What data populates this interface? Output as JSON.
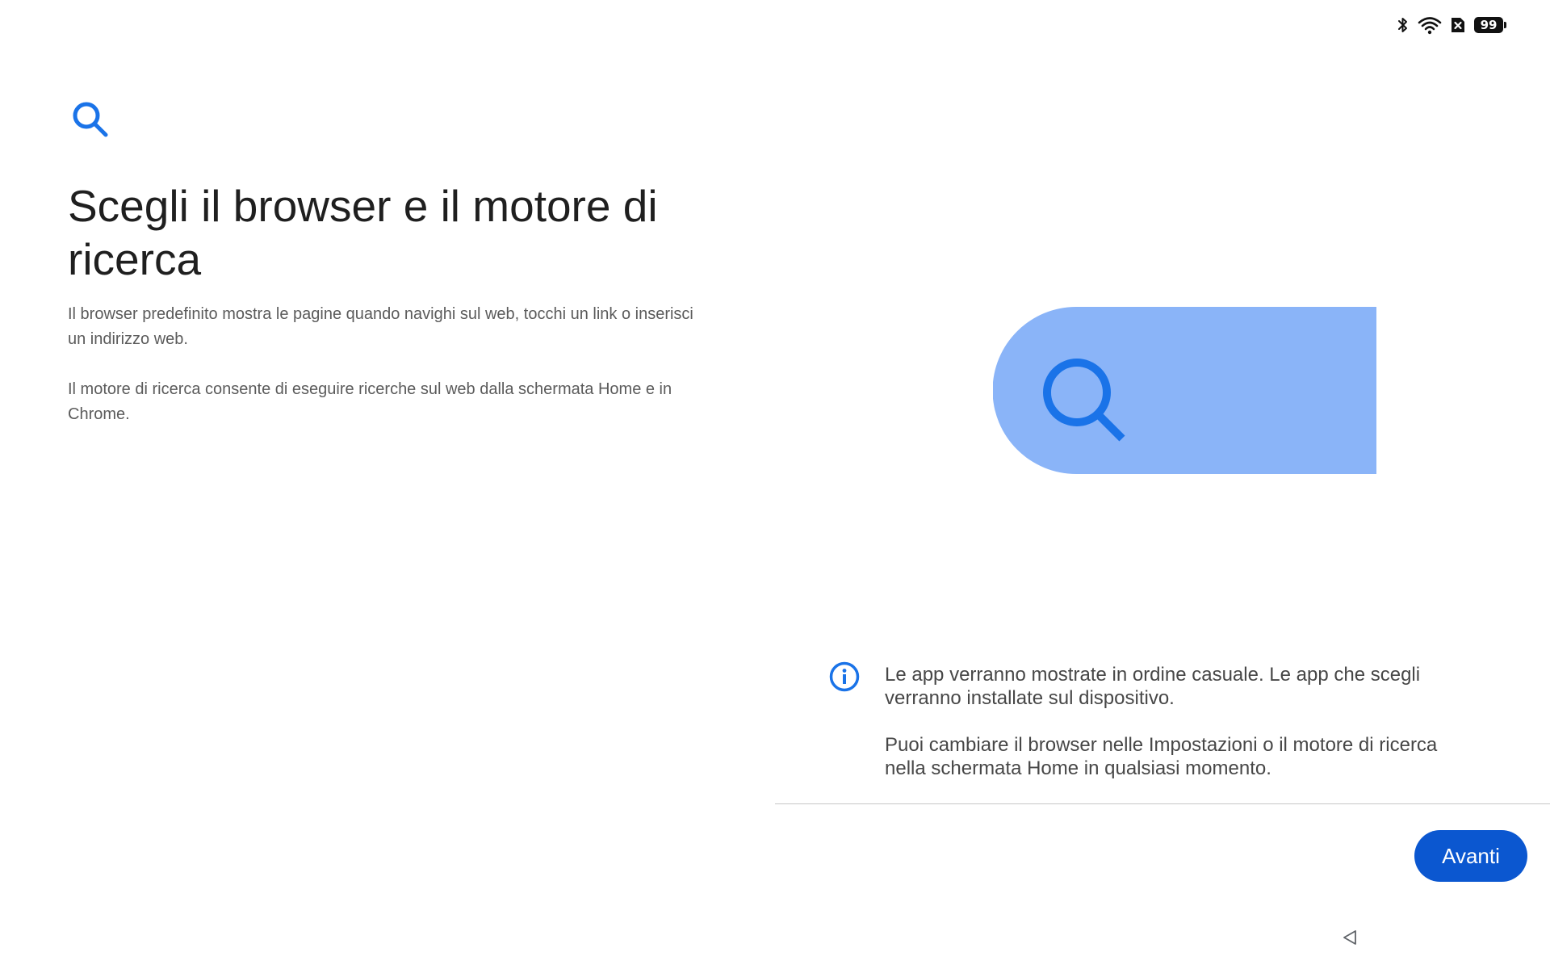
{
  "status_bar": {
    "icons": [
      "bluetooth-icon",
      "wifi-icon",
      "no-sim-icon"
    ],
    "battery_level": "99"
  },
  "header": {
    "icon": "search-icon",
    "title": "Scegli il browser e il motore di ricerca"
  },
  "descriptions": [
    "Il browser predefinito mostra le pagine quando navighi sul web, tocchi un link o inserisci un indirizzo web.",
    "Il motore di ricerca consente di eseguire ricerche sul web dalla schermata Home e in Chrome."
  ],
  "illustration": {
    "icon": "search-icon",
    "bar_color": "#8ab4f8",
    "icon_color": "#1a73e8"
  },
  "notice": {
    "icon": "info-icon",
    "lines": [
      "Le app verranno mostrate in ordine casuale. Le app che scegli verranno installate sul dispositivo.",
      "Puoi cambiare il browser nelle Impostazioni o il motore di ricerca nella schermata Home in qualsiasi momento."
    ]
  },
  "actions": {
    "next_label": "Avanti"
  },
  "navigation": {
    "back_icon": "back-triangle-icon"
  },
  "colors": {
    "accent": "#0b57d0",
    "icon_blue": "#1a73e8"
  }
}
